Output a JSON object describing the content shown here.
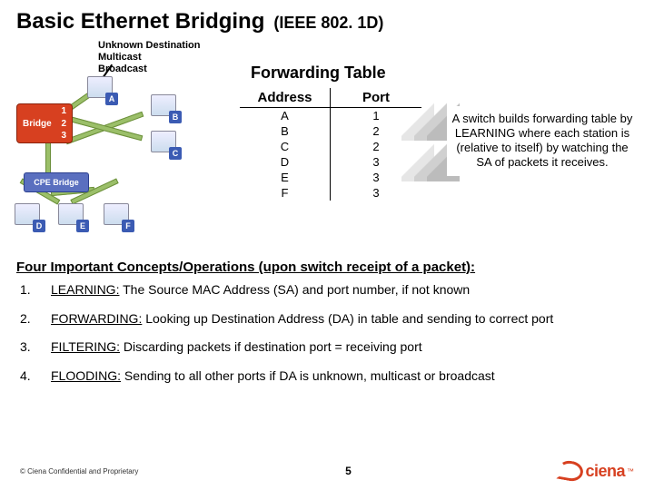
{
  "title": "Basic Ethernet Bridging",
  "subtitle": "(IEEE 802. 1D)",
  "note": {
    "l1": "Unknown Destination",
    "l2": "Multicast",
    "l3": "Broadcast"
  },
  "diagram": {
    "bridge_label": "Bridge",
    "cpe_label": "CPE Bridge",
    "ports": {
      "p1": "1",
      "p2": "2",
      "p3": "3"
    },
    "hosts": {
      "A": "A",
      "B": "B",
      "C": "C",
      "D": "D",
      "E": "E",
      "F": "F"
    }
  },
  "fwd": {
    "title": "Forwarding Table",
    "headers": {
      "address": "Address",
      "port": "Port"
    },
    "rows": [
      {
        "addr": "A",
        "port": "1"
      },
      {
        "addr": "B",
        "port": "2"
      },
      {
        "addr": "C",
        "port": "2"
      },
      {
        "addr": "D",
        "port": "3"
      },
      {
        "addr": "E",
        "port": "3"
      },
      {
        "addr": "F",
        "port": "3"
      }
    ]
  },
  "callout": "A switch builds forwarding table by LEARNING where each station is (relative to itself) by watching the SA of packets it receives.",
  "concepts_hdr": "Four Important Concepts/Operations (upon switch receipt of a packet):",
  "concepts": [
    {
      "n": "1.",
      "term": "LEARNING:",
      "desc": " The Source MAC Address (SA) and port number, if not known"
    },
    {
      "n": "2.",
      "term": "FORWARDING:",
      "desc": "  Looking up Destination Address (DA) in table and sending to correct port"
    },
    {
      "n": "3.",
      "term": "FILTERING:",
      "desc": "  Discarding packets if destination port = receiving port"
    },
    {
      "n": "4.",
      "term": "FLOODING:",
      "desc": "   Sending to all other ports if DA is unknown, multicast or broadcast"
    }
  ],
  "footer": {
    "copyright": "© Ciena Confidential and Proprietary",
    "page": "5",
    "logo": "ciena"
  },
  "chart_data": {
    "type": "table",
    "title": "Forwarding Table",
    "columns": [
      "Address",
      "Port"
    ],
    "rows": [
      [
        "A",
        1
      ],
      [
        "B",
        2
      ],
      [
        "C",
        2
      ],
      [
        "D",
        3
      ],
      [
        "E",
        3
      ],
      [
        "F",
        3
      ]
    ]
  }
}
